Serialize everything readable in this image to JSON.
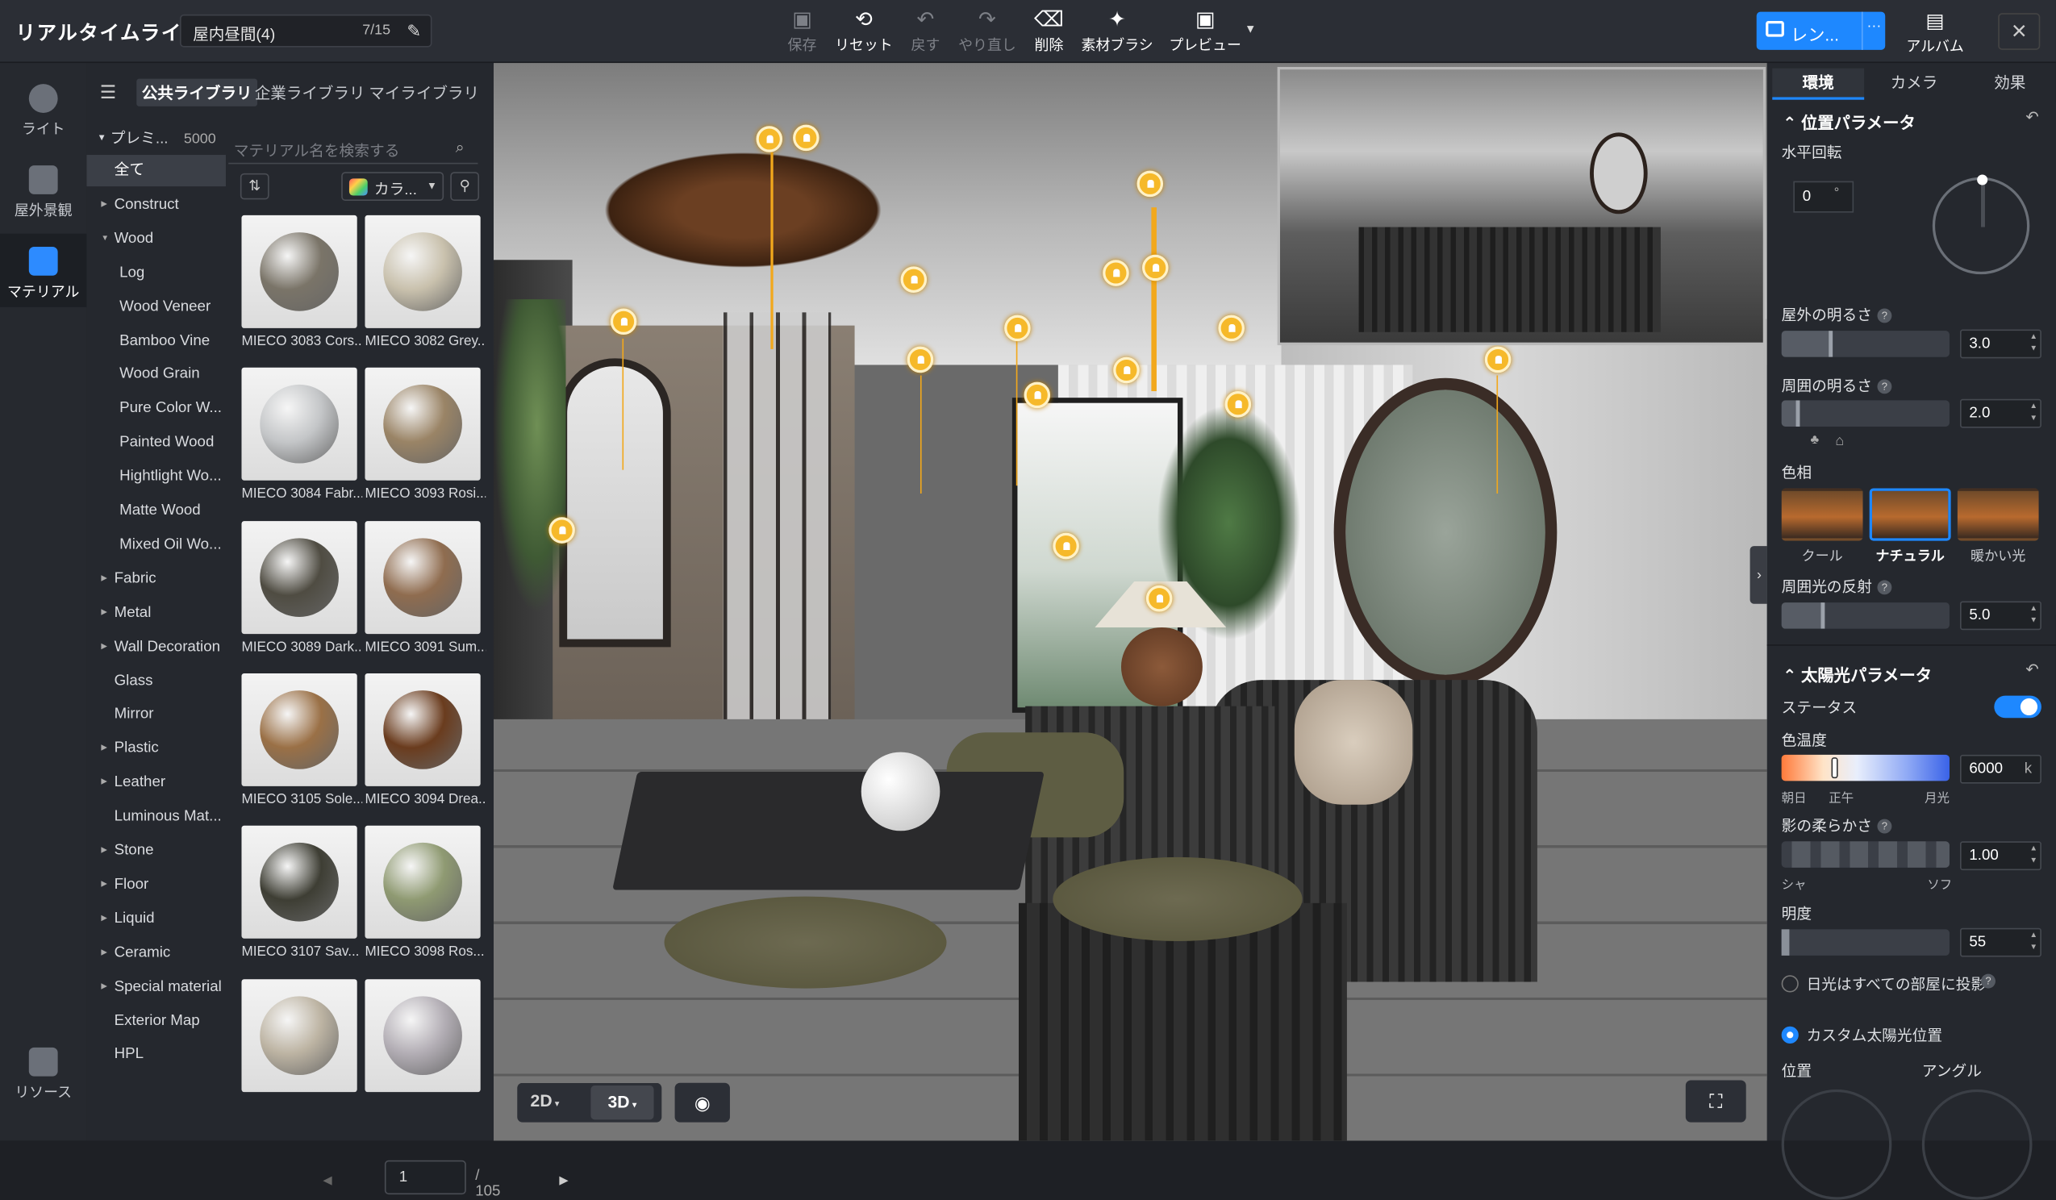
{
  "app": {
    "title": "リアルタイムライト"
  },
  "scene": {
    "name": "屋内昼間(4)",
    "counter": "7/15"
  },
  "toolbar": {
    "save": "保存",
    "reset": "リセット",
    "undo": "戻す",
    "redo": "やり直し",
    "delete": "削除",
    "brush": "素材ブラシ",
    "preview": "プレビュー",
    "render": "レン...",
    "render_more": "···",
    "album": "アルバム"
  },
  "rail": {
    "items": [
      "ライト",
      "屋外景観",
      "マテリアル",
      "リソース"
    ],
    "active": "マテリアル"
  },
  "library": {
    "tabs": [
      "公共ライブラリ",
      "企業ライブラリ",
      "マイライブラリ"
    ],
    "active_tab": "公共ライブラリ",
    "category_head": {
      "label": "プレミ...",
      "count": "5000"
    },
    "categories": [
      {
        "label": "全て",
        "level": 1,
        "arrow": false,
        "selected": true
      },
      {
        "label": "Construct",
        "level": 1,
        "arrow": true
      },
      {
        "label": "Wood",
        "level": 1,
        "arrow": true,
        "open": true
      },
      {
        "label": "Log",
        "level": 2
      },
      {
        "label": "Wood Veneer",
        "level": 2
      },
      {
        "label": "Bamboo Vine",
        "level": 2
      },
      {
        "label": "Wood Grain",
        "level": 2
      },
      {
        "label": "Pure Color W...",
        "level": 2
      },
      {
        "label": "Painted Wood",
        "level": 2
      },
      {
        "label": "Hightlight Wo...",
        "level": 2
      },
      {
        "label": "Matte Wood",
        "level": 2
      },
      {
        "label": "Mixed Oil Wo...",
        "level": 2
      },
      {
        "label": "Fabric",
        "level": 1,
        "arrow": true
      },
      {
        "label": "Metal",
        "level": 1,
        "arrow": true
      },
      {
        "label": "Wall Decoration",
        "level": 1,
        "arrow": true
      },
      {
        "label": "Glass",
        "level": 1
      },
      {
        "label": "Mirror",
        "level": 1
      },
      {
        "label": "Plastic",
        "level": 1,
        "arrow": true
      },
      {
        "label": "Leather",
        "level": 1,
        "arrow": true
      },
      {
        "label": "Luminous Mat...",
        "level": 1
      },
      {
        "label": "Stone",
        "level": 1,
        "arrow": true
      },
      {
        "label": "Floor",
        "level": 1,
        "arrow": true
      },
      {
        "label": "Liquid",
        "level": 1,
        "arrow": true
      },
      {
        "label": "Ceramic",
        "level": 1,
        "arrow": true
      },
      {
        "label": "Special material",
        "level": 1,
        "arrow": true
      },
      {
        "label": "Exterior Map",
        "level": 1
      },
      {
        "label": "HPL",
        "level": 1
      }
    ],
    "search_placeholder": "マテリアル名を検索する",
    "color_filter": "カラ...",
    "materials": [
      {
        "name": "MIECO 3083 Cors...",
        "color": "#7a7468"
      },
      {
        "name": "MIECO 3082 Grey...",
        "color": "#c9c1ad"
      },
      {
        "name": "MIECO 3084 Fabr...",
        "color": "#c4c6c8"
      },
      {
        "name": "MIECO 3093 Rosi...",
        "color": "#9a8466"
      },
      {
        "name": "MIECO 3089 Dark...",
        "color": "#4f4c42"
      },
      {
        "name": "MIECO 3091 Sum...",
        "color": "#8f6c4f"
      },
      {
        "name": "MIECO 3105 Sole...",
        "color": "#9a7046"
      },
      {
        "name": "MIECO 3094 Drea...",
        "color": "#6a3c1e"
      },
      {
        "name": "MIECO 3107 Sav...",
        "color": "#3e3e34"
      },
      {
        "name": "MIECO 3098 Ros...",
        "color": "#8f9a72"
      },
      {
        "name": "",
        "color": "#bdb4a3"
      },
      {
        "name": "",
        "color": "#b3aeb5"
      }
    ],
    "page": "1",
    "page_total": "/ 105"
  },
  "viewport": {
    "mode_2d": "2D",
    "mode_3d": "3D",
    "active_mode": "3D"
  },
  "right_panel": {
    "tabs": [
      "環境",
      "カメラ",
      "効果"
    ],
    "active_tab": "環境",
    "position_section": "位置パラメータ",
    "horizontal_rotation": {
      "label": "水平回転",
      "value": "0",
      "unit": "°"
    },
    "outdoor_brightness": {
      "label": "屋外の明るさ",
      "value": "3.0",
      "level": 0.3
    },
    "ambient_brightness": {
      "label": "周囲の明るさ",
      "value": "2.0",
      "level": 0.1
    },
    "hue": {
      "label": "色相",
      "presets": [
        "クール",
        "ナチュラル",
        "暖かい光"
      ],
      "selected": "ナチュラル"
    },
    "ambient_reflection": {
      "label": "周囲光の反射",
      "value": "5.0",
      "level": 0.25
    },
    "sun_section": "太陽光パラメータ",
    "status": {
      "label": "ステータス",
      "on": true
    },
    "color_temperature": {
      "label": "色温度",
      "value": "6000",
      "unit": "k",
      "ticks": [
        "朝日",
        "正午",
        "月光"
      ]
    },
    "shadow_softness": {
      "label": "影の柔らかさ",
      "value": "1.00",
      "ticks": [
        "シャ",
        "ソフ"
      ]
    },
    "brightness": {
      "label": "明度",
      "value": "55"
    },
    "sun_all_rooms": {
      "label": "日光はすべての部屋に投影",
      "checked": false
    },
    "custom_sun": {
      "label": "カスタム太陽光位置",
      "checked": true
    },
    "position_label": "位置",
    "angle_label": "アングル",
    "colors": {
      "accent": "#1e88ff",
      "light_marker": "#f6b92a"
    }
  }
}
